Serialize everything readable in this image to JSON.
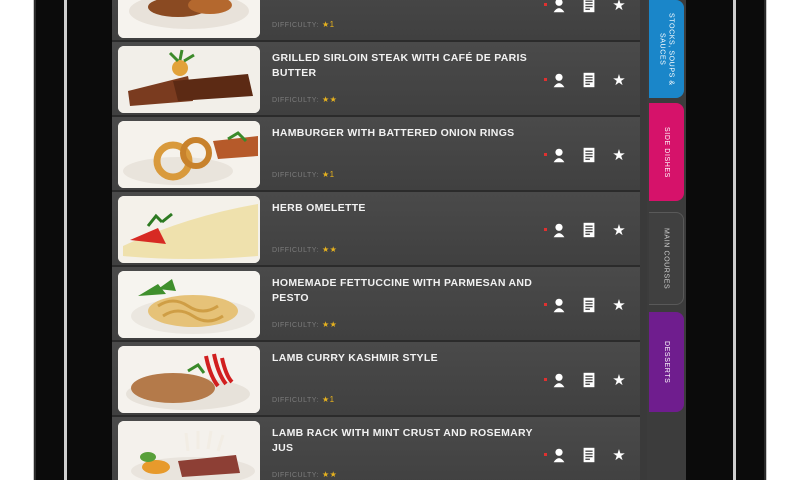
{
  "recipes": [
    {
      "title": "",
      "difficulty_label": "DIFFICULTY:",
      "stars": "★1"
    },
    {
      "title": "GRILLED SIRLOIN STEAK WITH CAFÉ DE PARIS BUTTER",
      "difficulty_label": "DIFFICULTY:",
      "stars": "★★"
    },
    {
      "title": "HAMBURGER WITH BATTERED ONION RINGS",
      "difficulty_label": "DIFFICULTY:",
      "stars": "★1"
    },
    {
      "title": "HERB OMELETTE",
      "difficulty_label": "DIFFICULTY:",
      "stars": "★★"
    },
    {
      "title": "HOMEMADE FETTUCCINE WITH PARMESAN AND PESTO",
      "difficulty_label": "DIFFICULTY:",
      "stars": "★★"
    },
    {
      "title": "LAMB CURRY KASHMIR STYLE",
      "difficulty_label": "DIFFICULTY:",
      "stars": "★1"
    },
    {
      "title": "LAMB RACK WITH MINT CRUST AND ROSEMARY JUS",
      "difficulty_label": "DIFFICULTY:",
      "stars": "★★"
    }
  ],
  "tabs": {
    "stocks": "STOCKS, SOUPS & SAUCES",
    "side": "SIDE DISHES",
    "main": "MAIN COURSES",
    "desserts": "DESSERTS"
  },
  "colors": {
    "stocks": "#1a86c9",
    "side": "#d6126a",
    "desserts": "#6f1d8e",
    "star": "#e7b21e"
  },
  "icons": [
    "chef-icon",
    "recipe-card-icon",
    "favorite-star-icon"
  ]
}
